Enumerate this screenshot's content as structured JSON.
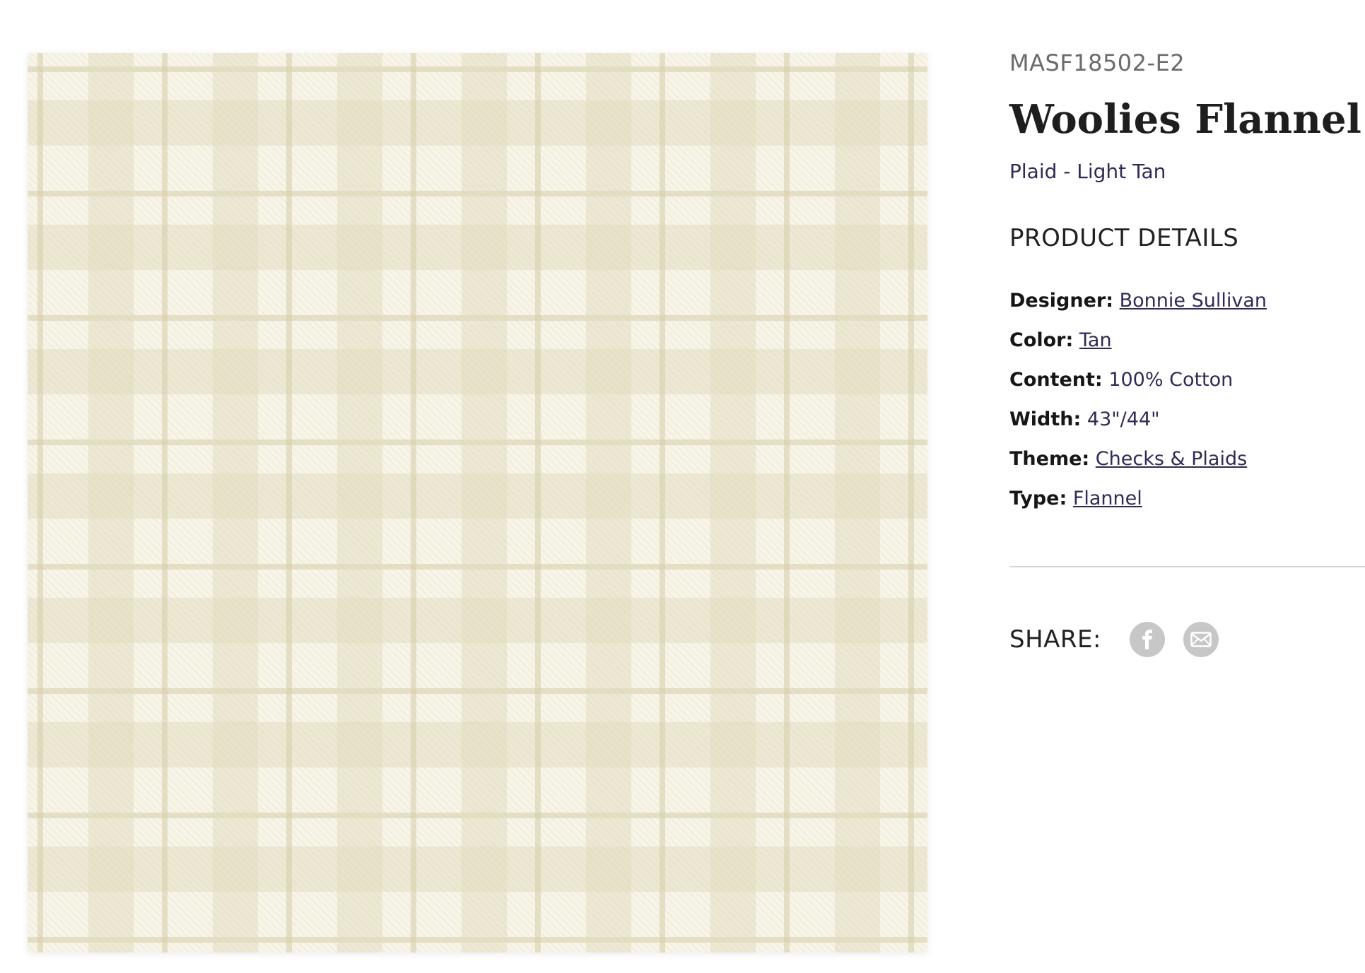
{
  "product": {
    "sku": "MASF18502-E2",
    "title": "Woolies Flannel",
    "subtitle": "Plaid - Light Tan"
  },
  "details": {
    "heading": "PRODUCT DETAILS",
    "designer": {
      "label": "Designer:",
      "value": "Bonnie Sullivan"
    },
    "color": {
      "label": "Color:",
      "value": "Tan"
    },
    "content": {
      "label": "Content:",
      "value": "100% Cotton"
    },
    "width": {
      "label": "Width:",
      "value": "43\"/44\""
    },
    "theme": {
      "label": "Theme:",
      "value": "Checks & Plaids"
    },
    "type": {
      "label": "Type:",
      "value": "Flannel"
    }
  },
  "share": {
    "label": "SHARE:",
    "icons": [
      "facebook-icon",
      "email-icon"
    ]
  },
  "colors": {
    "accent": "#2f2b56",
    "swatch_base": "#f7f4e8",
    "icon_bg": "#c7c7c7"
  }
}
